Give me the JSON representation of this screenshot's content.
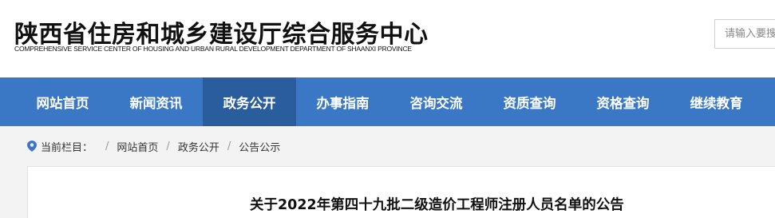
{
  "header": {
    "title": "陕西省住房和城乡建设厅综合服务中心",
    "subtitle": "COMPREHENSIVE SERVICE CENTER OF HOUSING AND URBAN RURAL DEVELOPMENT DEPARTMENT OF SHAANXI PROVINCE",
    "search_placeholder": "请输入要搜"
  },
  "nav": {
    "items": [
      {
        "label": "网站首页"
      },
      {
        "label": "新闻资讯"
      },
      {
        "label": "政务公开",
        "active": true
      },
      {
        "label": "办事指南"
      },
      {
        "label": "咨询交流"
      },
      {
        "label": "资质查询"
      },
      {
        "label": "资格查询"
      },
      {
        "label": "继续教育"
      }
    ]
  },
  "breadcrumb": {
    "label": "当前栏目：",
    "items": [
      "网站首页",
      "政务公开",
      "公告公示"
    ]
  },
  "article": {
    "title": "关于2022年第四十九批二级造价工程师注册人员名单的公告"
  },
  "colors": {
    "nav_bg": "#3a77c5",
    "nav_active": "#2a5d9d",
    "breadcrumb_bg": "#f3f3f3"
  }
}
